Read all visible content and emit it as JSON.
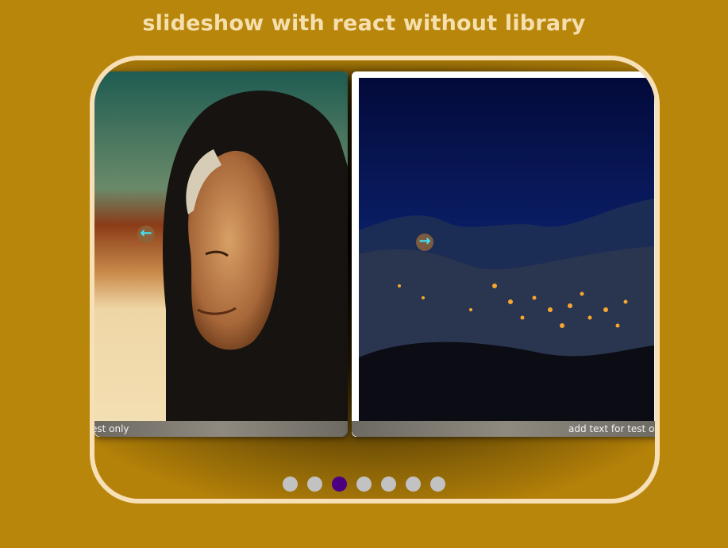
{
  "title": "slideshow with react without library",
  "slides": [
    {
      "caption": "add text for test only",
      "visible_caption": "est only"
    },
    {
      "caption": "add text for test only",
      "visible_caption": "add text for test o"
    }
  ],
  "controls": {
    "prev_icon": "←",
    "next_icon": "→"
  },
  "dots": {
    "count": 7,
    "active_index": 2
  },
  "colors": {
    "background": "#b8860b",
    "frame": "#f7dfb6",
    "title": "#f6dfae",
    "dot": "#c2c2c2",
    "dot_active": "#4b0082",
    "arrow": "#3ee8ff"
  }
}
